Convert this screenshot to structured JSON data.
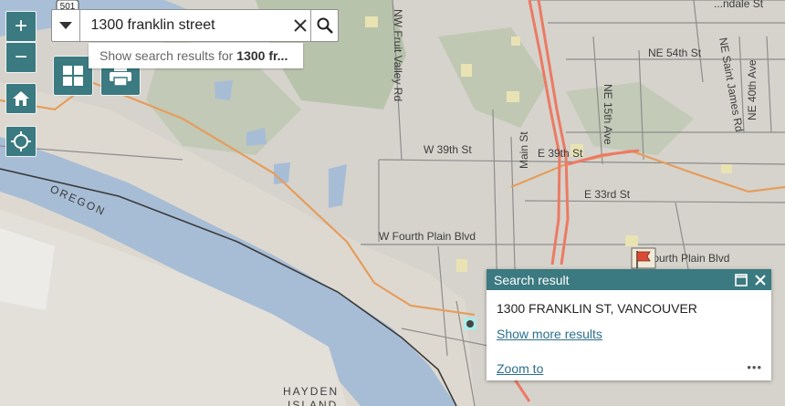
{
  "map": {
    "labels": {
      "oregon": "OREGON",
      "hayden_island": "HAYDEN",
      "island": "ISLAND",
      "fruit_valley": "NW Fruit Valley Rd",
      "w39": "W 39th St",
      "e39": "E 39th St",
      "e33": "E 33rd St",
      "main_st": "Main St",
      "ne15": "NE 15th Ave",
      "ne54": "NE 54th St",
      "saint_james": "NE Saint James Rd",
      "ne40": "NE 40th Ave",
      "w_fourth_plain": "W Fourth Plain Blvd",
      "e_fourth_plain": "Fourth Plain Blvd",
      "route_501": "501",
      "top_partial": "...ndale St"
    },
    "colors": {
      "land": "#d6d3cc",
      "water": "#a7bdd6",
      "green": "#b7c5ad",
      "highway": "#ec7a63",
      "arterial": "#e59d5c",
      "road": "#8d8d8d",
      "accent": "#3a7a80"
    }
  },
  "controls": {
    "zoom_in": "+",
    "zoom_out": "−",
    "home_icon": "home-icon",
    "locate_icon": "locate-icon",
    "basemap_icon": "basemap-gallery-icon",
    "print_icon": "print-icon"
  },
  "search": {
    "value": "1300 franklin street",
    "suggestion_prefix": "Show search results for",
    "suggestion_term": "1300 fr..."
  },
  "popup": {
    "title": "Search result",
    "address": "1300 FRANKLIN ST, VANCOUVER",
    "more_link": "Show more results",
    "zoom_link": "Zoom to",
    "menu": "•••"
  }
}
